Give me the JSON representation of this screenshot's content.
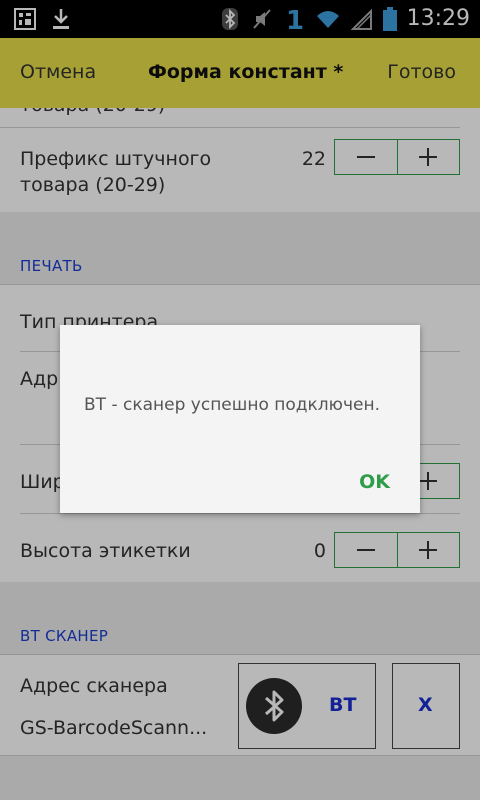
{
  "status_bar": {
    "time": "13:29",
    "icons": [
      "barcode-icon",
      "download-icon",
      "bluetooth-icon",
      "mute-icon",
      "sim-icon",
      "wifi-icon",
      "no-signal-icon",
      "battery-icon"
    ]
  },
  "action_bar": {
    "cancel": "Отмена",
    "title": "Форма констант *",
    "done": "Готово"
  },
  "rows": {
    "cut_label": "товара (20-29)",
    "piece_prefix_label_1": "Префикс штучного",
    "piece_prefix_label_2": "товара (20-29)",
    "piece_prefix_value": "22"
  },
  "sections": {
    "print": "ПЕЧАТЬ",
    "bt_scanner": "ВТ СКАНЕР"
  },
  "print_rows": {
    "printer_type": "Тип принтера",
    "address_partial": "Адр",
    "width_partial": "Шир",
    "label_height": "Высота этикетки",
    "label_height_value": "0"
  },
  "scanner": {
    "address_label": "Адрес сканера",
    "address_value": "GS-BarcodeScann...",
    "bt_button": "BT",
    "x_button": "X"
  },
  "dialog": {
    "message": "ВТ - сканер успешно подключен.",
    "ok": "OK"
  },
  "colors": {
    "accent_green": "#2e9d4a",
    "section_blue": "#1a3ed0",
    "action_bar": "#e8e04a"
  }
}
